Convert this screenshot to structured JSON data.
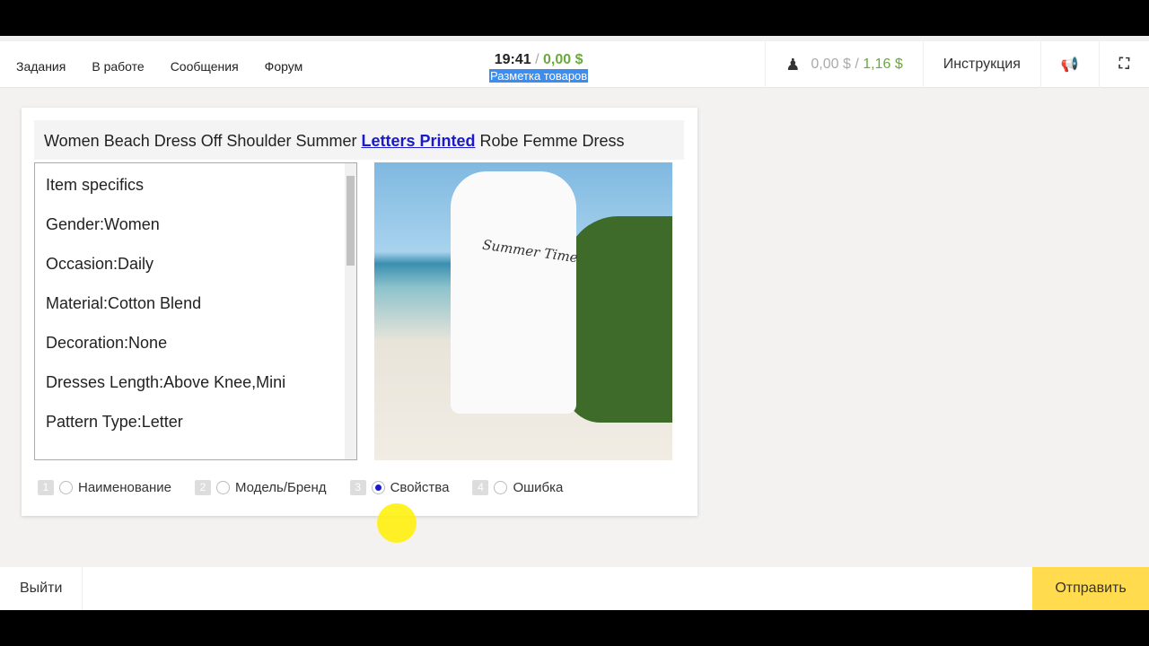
{
  "nav": [
    "Задания",
    "В работе",
    "Сообщения",
    "Форум"
  ],
  "status": {
    "time": "19:41",
    "separator": "/",
    "earned": "0,00 $",
    "task": "Разметка товаров"
  },
  "balance": {
    "pending": "0,00 $",
    "separator": "/",
    "total": "1,16 $"
  },
  "instruction": "Инструкция",
  "product": {
    "title_before": "Women Beach Dress Off Shoulder Summer ",
    "title_link": "Letters Printed",
    "title_after": " Robe Femme Dress",
    "specs": [
      "Item specifics",
      "Gender:Women",
      "Occasion:Daily",
      "Material:Cotton Blend",
      "Decoration:None",
      "Dresses Length:Above Knee,Mini",
      "Pattern Type:Letter"
    ],
    "image_text": "Summer Time"
  },
  "options": [
    {
      "num": "1",
      "label": "Наименование",
      "checked": false
    },
    {
      "num": "2",
      "label": "Модель/Бренд",
      "checked": false
    },
    {
      "num": "3",
      "label": "Свойства",
      "checked": true
    },
    {
      "num": "4",
      "label": "Ошибка",
      "checked": false
    }
  ],
  "footer": {
    "exit": "Выйти",
    "submit": "Отправить"
  }
}
